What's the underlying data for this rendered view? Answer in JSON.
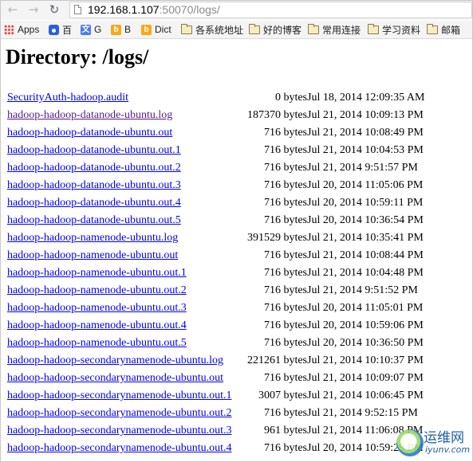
{
  "browser": {
    "url_host": "192.168.1.107",
    "url_rest": ":50070/logs/",
    "bookmarks": [
      {
        "label": "Apps",
        "icon": "apps-grid-icon"
      },
      {
        "label": "百",
        "icon": "baidu-paw-icon"
      },
      {
        "label": "G",
        "icon": "google-translate-icon"
      },
      {
        "label": "B",
        "icon": "bing-icon"
      },
      {
        "label": "Dict",
        "icon": "bing-icon"
      },
      {
        "label": "各系统地址",
        "icon": "folder-icon"
      },
      {
        "label": "好的博客",
        "icon": "folder-icon"
      },
      {
        "label": "常用连接",
        "icon": "folder-icon"
      },
      {
        "label": "学习资料",
        "icon": "folder-icon"
      },
      {
        "label": "邮箱",
        "icon": "folder-icon"
      }
    ]
  },
  "page": {
    "heading": "Directory: /logs/"
  },
  "files": [
    {
      "name": "SecurityAuth-hadoop.audit",
      "size": "0 bytes",
      "date": "Jul 18, 2014 12:09:35 AM",
      "visited": false
    },
    {
      "name": "hadoop-hadoop-datanode-ubuntu.log",
      "size": "187370 bytes",
      "date": "Jul 21, 2014 10:09:13 PM",
      "visited": true
    },
    {
      "name": "hadoop-hadoop-datanode-ubuntu.out",
      "size": "716 bytes",
      "date": "Jul 21, 2014 10:08:49 PM",
      "visited": false
    },
    {
      "name": "hadoop-hadoop-datanode-ubuntu.out.1",
      "size": "716 bytes",
      "date": "Jul 21, 2014 10:04:53 PM",
      "visited": false
    },
    {
      "name": "hadoop-hadoop-datanode-ubuntu.out.2",
      "size": "716 bytes",
      "date": "Jul 21, 2014 9:51:57 PM",
      "visited": false
    },
    {
      "name": "hadoop-hadoop-datanode-ubuntu.out.3",
      "size": "716 bytes",
      "date": "Jul 20, 2014 11:05:06 PM",
      "visited": false
    },
    {
      "name": "hadoop-hadoop-datanode-ubuntu.out.4",
      "size": "716 bytes",
      "date": "Jul 20, 2014 10:59:11 PM",
      "visited": false
    },
    {
      "name": "hadoop-hadoop-datanode-ubuntu.out.5",
      "size": "716 bytes",
      "date": "Jul 20, 2014 10:36:54 PM",
      "visited": false
    },
    {
      "name": "hadoop-hadoop-namenode-ubuntu.log",
      "size": "391529 bytes",
      "date": "Jul 21, 2014 10:35:41 PM",
      "visited": false
    },
    {
      "name": "hadoop-hadoop-namenode-ubuntu.out",
      "size": "716 bytes",
      "date": "Jul 21, 2014 10:08:44 PM",
      "visited": false
    },
    {
      "name": "hadoop-hadoop-namenode-ubuntu.out.1",
      "size": "716 bytes",
      "date": "Jul 21, 2014 10:04:48 PM",
      "visited": false
    },
    {
      "name": "hadoop-hadoop-namenode-ubuntu.out.2",
      "size": "716 bytes",
      "date": "Jul 21, 2014 9:51:52 PM",
      "visited": false
    },
    {
      "name": "hadoop-hadoop-namenode-ubuntu.out.3",
      "size": "716 bytes",
      "date": "Jul 20, 2014 11:05:01 PM",
      "visited": false
    },
    {
      "name": "hadoop-hadoop-namenode-ubuntu.out.4",
      "size": "716 bytes",
      "date": "Jul 20, 2014 10:59:06 PM",
      "visited": false
    },
    {
      "name": "hadoop-hadoop-namenode-ubuntu.out.5",
      "size": "716 bytes",
      "date": "Jul 20, 2014 10:36:50 PM",
      "visited": false
    },
    {
      "name": "hadoop-hadoop-secondarynamenode-ubuntu.log",
      "size": "221261 bytes",
      "date": "Jul 21, 2014 10:10:37 PM",
      "visited": false
    },
    {
      "name": "hadoop-hadoop-secondarynamenode-ubuntu.out",
      "size": "716 bytes",
      "date": "Jul 21, 2014 10:09:07 PM",
      "visited": false
    },
    {
      "name": "hadoop-hadoop-secondarynamenode-ubuntu.out.1",
      "size": "3007 bytes",
      "date": "Jul 21, 2014 10:06:45 PM",
      "visited": false
    },
    {
      "name": "hadoop-hadoop-secondarynamenode-ubuntu.out.2",
      "size": "716 bytes",
      "date": "Jul 21, 2014 9:52:15 PM",
      "visited": false
    },
    {
      "name": "hadoop-hadoop-secondarynamenode-ubuntu.out.3",
      "size": "961 bytes",
      "date": "Jul 21, 2014 11:06:08 PM",
      "visited": false
    },
    {
      "name": "hadoop-hadoop-secondarynamenode-ubuntu.out.4",
      "size": "716 bytes",
      "date": "Jul 20, 2014 10:59:29 PM",
      "visited": false
    }
  ],
  "watermark": {
    "text": "运维网",
    "sub": "iyunv.com"
  }
}
